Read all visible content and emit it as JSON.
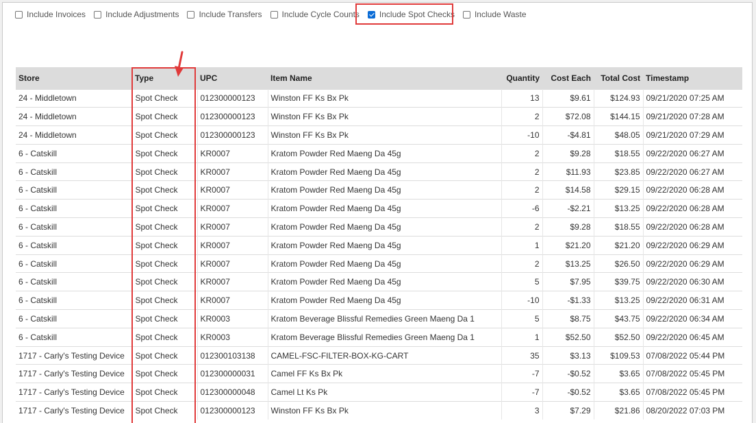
{
  "filters": [
    {
      "label": "Include Invoices",
      "checked": false
    },
    {
      "label": "Include Adjustments",
      "checked": false
    },
    {
      "label": "Include Transfers",
      "checked": false
    },
    {
      "label": "Include Cycle Counts",
      "checked": false
    },
    {
      "label": "Include Spot Checks",
      "checked": true
    },
    {
      "label": "Include Waste",
      "checked": false
    }
  ],
  "table": {
    "headers": [
      "Store",
      "Type",
      "UPC",
      "Item Name",
      "Quantity",
      "Cost Each",
      "Total Cost",
      "Timestamp"
    ],
    "rows": [
      [
        "24 - Middletown",
        "Spot Check",
        "012300000123",
        "Winston FF Ks Bx Pk",
        "13",
        "$9.61",
        "$124.93",
        "09/21/2020 07:25 AM"
      ],
      [
        "24 - Middletown",
        "Spot Check",
        "012300000123",
        "Winston FF Ks Bx Pk",
        "2",
        "$72.08",
        "$144.15",
        "09/21/2020 07:28 AM"
      ],
      [
        "24 - Middletown",
        "Spot Check",
        "012300000123",
        "Winston FF Ks Bx Pk",
        "-10",
        "-$4.81",
        "$48.05",
        "09/21/2020 07:29 AM"
      ],
      [
        "6 - Catskill",
        "Spot Check",
        "KR0007",
        "Kratom Powder Red Maeng Da 45g",
        "2",
        "$9.28",
        "$18.55",
        "09/22/2020 06:27 AM"
      ],
      [
        "6 - Catskill",
        "Spot Check",
        "KR0007",
        "Kratom Powder Red Maeng Da 45g",
        "2",
        "$11.93",
        "$23.85",
        "09/22/2020 06:27 AM"
      ],
      [
        "6 - Catskill",
        "Spot Check",
        "KR0007",
        "Kratom Powder Red Maeng Da 45g",
        "2",
        "$14.58",
        "$29.15",
        "09/22/2020 06:28 AM"
      ],
      [
        "6 - Catskill",
        "Spot Check",
        "KR0007",
        "Kratom Powder Red Maeng Da 45g",
        "-6",
        "-$2.21",
        "$13.25",
        "09/22/2020 06:28 AM"
      ],
      [
        "6 - Catskill",
        "Spot Check",
        "KR0007",
        "Kratom Powder Red Maeng Da 45g",
        "2",
        "$9.28",
        "$18.55",
        "09/22/2020 06:28 AM"
      ],
      [
        "6 - Catskill",
        "Spot Check",
        "KR0007",
        "Kratom Powder Red Maeng Da 45g",
        "1",
        "$21.20",
        "$21.20",
        "09/22/2020 06:29 AM"
      ],
      [
        "6 - Catskill",
        "Spot Check",
        "KR0007",
        "Kratom Powder Red Maeng Da 45g",
        "2",
        "$13.25",
        "$26.50",
        "09/22/2020 06:29 AM"
      ],
      [
        "6 - Catskill",
        "Spot Check",
        "KR0007",
        "Kratom Powder Red Maeng Da 45g",
        "5",
        "$7.95",
        "$39.75",
        "09/22/2020 06:30 AM"
      ],
      [
        "6 - Catskill",
        "Spot Check",
        "KR0007",
        "Kratom Powder Red Maeng Da 45g",
        "-10",
        "-$1.33",
        "$13.25",
        "09/22/2020 06:31 AM"
      ],
      [
        "6 - Catskill",
        "Spot Check",
        "KR0003",
        "Kratom Beverage Blissful Remedies Green Maeng Da 1",
        "5",
        "$8.75",
        "$43.75",
        "09/22/2020 06:34 AM"
      ],
      [
        "6 - Catskill",
        "Spot Check",
        "KR0003",
        "Kratom Beverage Blissful Remedies Green Maeng Da 1",
        "1",
        "$52.50",
        "$52.50",
        "09/22/2020 06:45 AM"
      ],
      [
        "1717 - Carly's Testing Device",
        "Spot Check",
        "012300103138",
        "CAMEL-FSC-FILTER-BOX-KG-CART",
        "35",
        "$3.13",
        "$109.53",
        "07/08/2022 05:44 PM"
      ],
      [
        "1717 - Carly's Testing Device",
        "Spot Check",
        "012300000031",
        "Camel FF Ks Bx Pk",
        "-7",
        "-$0.52",
        "$3.65",
        "07/08/2022 05:45 PM"
      ],
      [
        "1717 - Carly's Testing Device",
        "Spot Check",
        "012300000048",
        "Camel Lt Ks Pk",
        "-7",
        "-$0.52",
        "$3.65",
        "07/08/2022 05:45 PM"
      ],
      [
        "1717 - Carly's Testing Device",
        "Spot Check",
        "012300000123",
        "Winston FF Ks Bx Pk",
        "3",
        "$7.29",
        "$21.86",
        "08/20/2022 07:03 PM"
      ]
    ]
  },
  "colors": {
    "highlight": "#e03a3a",
    "checkbox_checked": "#0b6cd6",
    "header_bg": "#dcdcdc"
  }
}
